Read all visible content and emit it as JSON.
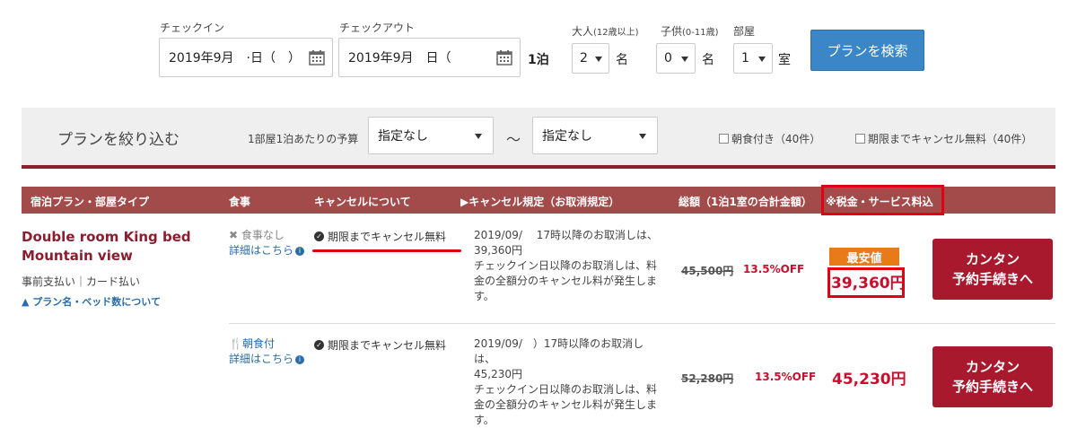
{
  "search": {
    "checkin_label": "チェックイン",
    "checkout_label": "チェックアウト",
    "checkin_value": "2019年9月　·日（　）",
    "checkout_value": "2019年9月　日（",
    "nights": "1泊",
    "adults_label": "大人",
    "adults_sub": "(12歳以上)",
    "children_label": "子供",
    "children_sub": "(0-11歳)",
    "rooms_label": "部屋",
    "adults_value": "2",
    "adults_unit": "名",
    "children_value": "0",
    "children_unit": "名",
    "rooms_value": "1",
    "rooms_unit": "室",
    "search_button": "プランを検索"
  },
  "filter": {
    "title": "プランを絞り込む",
    "budget_label": "1部屋1泊あたりの予算",
    "min_value": "指定なし",
    "tilde": "〜",
    "max_value": "指定なし",
    "breakfast_filter": "朝食付き（40件）",
    "free_cancel_filter": "期限までキャンセル無料（40件）"
  },
  "table_header": {
    "plan": "宿泊プラン・部屋タイプ",
    "meal": "食事",
    "cancel": "キャンセルについて",
    "policy": "▶キャンセル規定（お取消規定）",
    "total": "総額（1泊1室の合計金額）",
    "tax_note": "※税金・サービス料込"
  },
  "room": {
    "name": "Double room King bed Mountain view",
    "payment": "事前支払い｜カード払い",
    "note": "プラン名・ベッド数について"
  },
  "plans": [
    {
      "meal": "食事なし",
      "details": "詳細はこちら",
      "cancel": "期限までキャンセル無料",
      "policy_line1": "2019/09/　 17時以降のお取消しは、",
      "policy_line2": "39,360円",
      "policy_line3": "チェックイン日以降のお取消しは、料金の全額分のキャンセル料が発生します。",
      "original_price": "45,500円",
      "discount": "13.5%OFF",
      "badge": "最安値",
      "price": "39,360円",
      "cta_line1": "カンタン",
      "cta_line2": "予約手続きへ"
    },
    {
      "meal": "朝食付",
      "details": "詳細はこちら",
      "cancel": "期限までキャンセル無料",
      "policy_line1": "2019/09/　）17時以降のお取消しは、",
      "policy_line2": "45,230円",
      "policy_line3": "チェックイン日以降のお取消しは、料金の全額分のキャンセル料が発生します。",
      "original_price": "52,280円",
      "discount": "13.5%OFF",
      "price": "45,230円",
      "cta_line1": "カンタン",
      "cta_line2": "予約手続きへ"
    }
  ],
  "colors": {
    "brand_red": "#a8192e",
    "header_red": "#a34a4a",
    "search_blue": "#3b86c6",
    "badge_orange": "#e87a17",
    "highlight_red": "#e00012"
  }
}
